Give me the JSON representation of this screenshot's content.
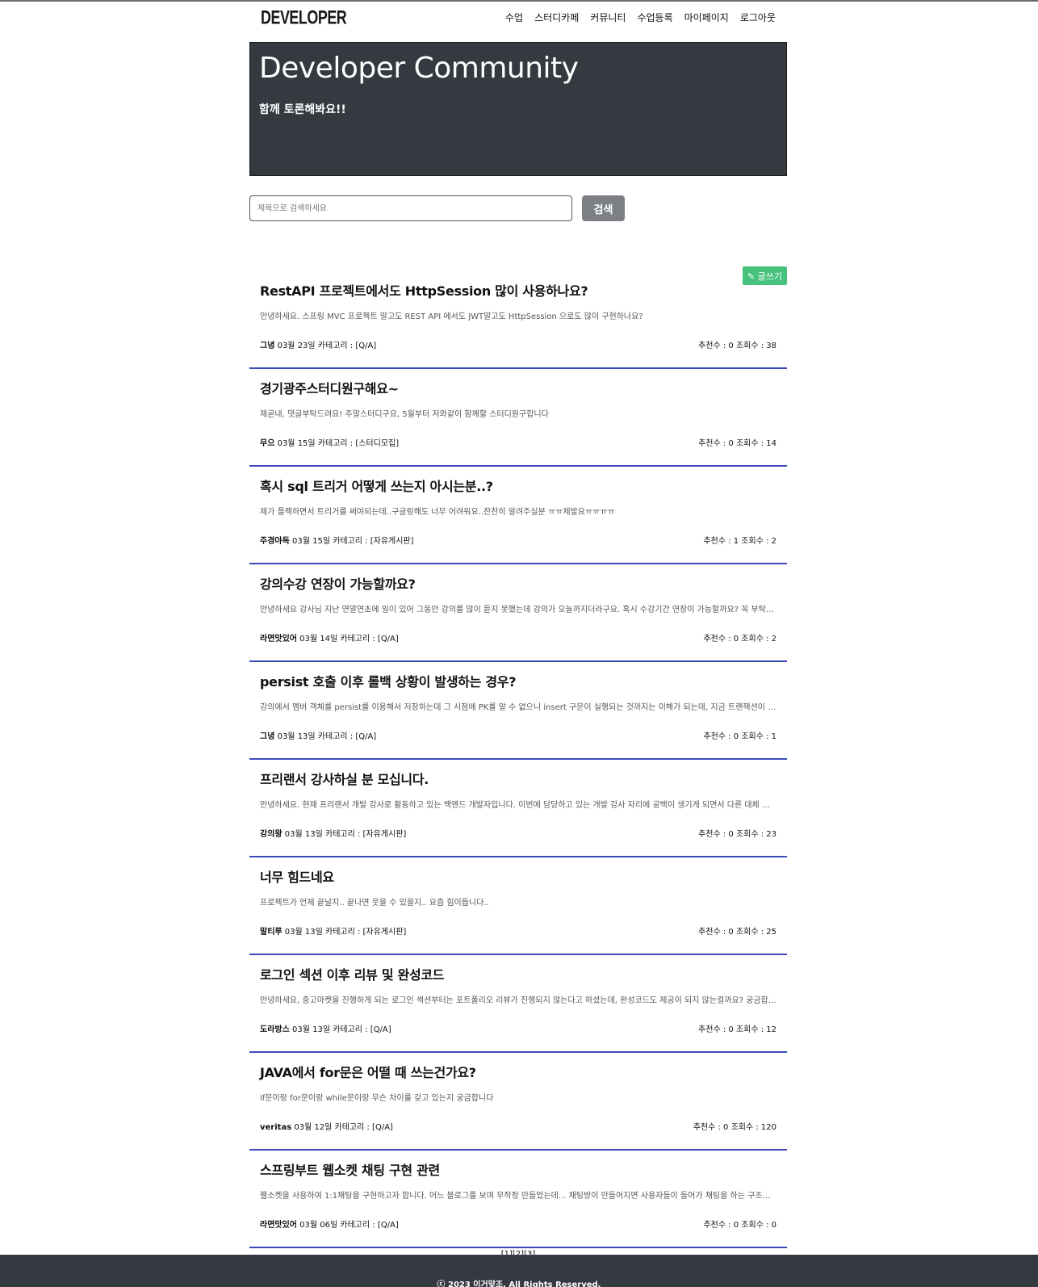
{
  "nav": {
    "logo": "DEVELOPER",
    "menu": [
      "수업",
      "스터디카페",
      "커뮤니티",
      "수업등록",
      "마이페이지",
      "로그아웃"
    ]
  },
  "hero": {
    "title": "Developer Community",
    "subtitle": "함께 토론해봐요!!"
  },
  "search": {
    "placeholder": "제목으로 검색하세요",
    "button": "검색"
  },
  "write_button": "✎ 글쓰기",
  "posts": [
    {
      "title": "RestAPI 프로젝트에서도 HttpSession 많이 사용하나요?",
      "excerpt": "안녕하세요. 스프링 MVC 프로젝트 말고도 REST API 에서도 JWT말고도 HttpSession 으로도 많이 구현하나요?",
      "author": "그녕",
      "info": " 03월 23일 카테고리 : [Q/A]",
      "stats": "추천수 : 0 조회수 : 38"
    },
    {
      "title": "경기광주스터디원구해요~",
      "excerpt": "제곧내, 댓글부탁드려요! 주말스터디구요, 5월부터 저와같이 함께할 스터디원구합니다",
      "author": "무으",
      "info": " 03월 15일 카테고리 : [스터디모집]",
      "stats": "추천수 : 0 조회수 : 14"
    },
    {
      "title": "혹시 sql 트리거 어떻게 쓰는지 아시는분..?",
      "excerpt": "제가 플젝하면서 트리거를 써야되는데..구글링해도 너무 어려워요..찬찬히 알려주실분 ㅠㅠ제발요ㅠㅠㅠㅠ",
      "author": "주경야독",
      "info": " 03월 15일 카테고리 : [자유게시판]",
      "stats": "추천수 : 1 조회수 : 2"
    },
    {
      "title": "강의수강 연장이 가능할까요?",
      "excerpt": "안녕하세요 강사님 지난 연말연초에 일이 있어 그동안 강의를 많이 듣지 못했는데 강의가 오늘까지더라구요. 혹시 수강기간 연장이 가능할까요? 꼭 부탁드립니다",
      "author": "라면맛있어",
      "info": " 03월 14일 카테고리 : [Q/A]",
      "stats": "추천수 : 0 조회수 : 2"
    },
    {
      "title": "persist 호출 이후 롤백 상황이 발생하는 경우?",
      "excerpt": "강의에서 멤버 객체를 persist를 이용해서 저장하는데 그 시점에 PK를 알 수 없으니 insert 구문이 실행되는 것까지는 이해가 되는데, 지금 트랜잭션이 롤백되면",
      "author": "그녕",
      "info": " 03월 13일 카테고리 : [Q/A]",
      "stats": "추천수 : 0 조회수 : 1"
    },
    {
      "title": "프리랜서 강사하실 분 모십니다.",
      "excerpt": "안녕하세요. 현재 프리랜서 개발 강사로 활동하고 있는 백엔드 개발자입니다. 이번에 담당하고 있는 개발 강사 자리에 공백이 생기게 되면서 다른 대체 강사분을 구합니다",
      "author": "강의왕",
      "info": " 03월 13일 카테고리 : [자유게시판]",
      "stats": "추천수 : 0 조회수 : 23"
    },
    {
      "title": "너무 힘드네요",
      "excerpt": "프로젝트가 언제 끝날지.. 끝나면 웃을 수 있을지.. 요즘 힘이듭니다..",
      "author": "말티루",
      "info": " 03월 13일 카테고리 : [자유게시판]",
      "stats": "추천수 : 0 조회수 : 25"
    },
    {
      "title": "로그인 섹션 이후 리뷰 및 완성코드",
      "excerpt": "안녕하세요, 중고마켓을 진행하게 되는 로그인 섹션부터는 포트폴리오 리뷰가 진행되지 않는다고 하셨는데, 완성코드도 제공이 되지 않는걸까요? 궁금합니다",
      "author": "도라방스",
      "info": " 03월 13일 카테고리 : [Q/A]",
      "stats": "추천수 : 0 조회수 : 12"
    },
    {
      "title": "JAVA에서 for문은 어떨 때 쓰는건가요?",
      "excerpt": "if문이랑 for문이랑 while문이랑 무슨 차이를 갖고 있는지 궁금합니다",
      "author": "veritas",
      "info": " 03월 12일 카테고리 : [Q/A]",
      "stats": "추천수 : 0 조회수 : 120"
    },
    {
      "title": "스프링부트 웹소켓 채팅 구현 관련",
      "excerpt": "웹소켓을 사용하여 1:1채팅을 구현하고자 합니다. 어느 블로그를 보며 무작정 만들었는데... 채팅방이 만들어지면 사용자들이 들어가 채팅을 하는 구조입니다",
      "author": "라면맛있어",
      "info": " 03월 06일 카테고리 : [Q/A]",
      "stats": "추천수 : 0 조회수 : 0"
    }
  ],
  "pagination": [
    "[1]",
    "[2]",
    "[3]"
  ],
  "footer": "ⓒ 2023 이거맞조. All Rights Reserved."
}
